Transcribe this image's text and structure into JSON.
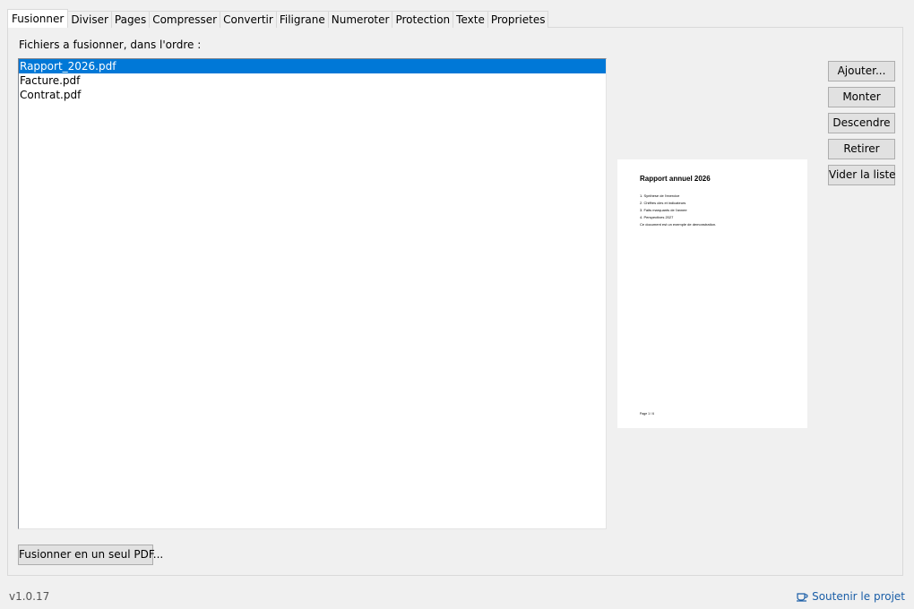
{
  "tabs": [
    "Fusionner",
    "Diviser",
    "Pages",
    "Compresser",
    "Convertir",
    "Filigrane",
    "Numeroter",
    "Protection",
    "Texte",
    "Proprietes"
  ],
  "merge": {
    "list_label": "Fichiers a fusionner, dans l'ordre :",
    "files": [
      "Rapport_2026.pdf",
      "Facture.pdf",
      "Contrat.pdf"
    ],
    "selected_file": "Rapport_2026.pdf",
    "buttons": {
      "add": "Ajouter...",
      "up": "Monter",
      "down": "Descendre",
      "remove": "Retirer",
      "clear": "Vider la liste"
    },
    "merge_button": "Fusionner en un seul PDF..."
  },
  "preview": {
    "title": "Rapport annuel 2026",
    "lines": [
      "1. Synthese de l'exercice",
      "2. Chiffres cles et indicateurs",
      "3. Faits marquants de l'annee",
      "4. Perspectives 2027",
      "Ce document est un exemple de demonstration."
    ],
    "footer": "Page 1 / 6"
  },
  "footer": {
    "version": "v1.0.17",
    "support_label": "Soutenir le projet",
    "support_icon": "coffee-cup-icon"
  },
  "colors": {
    "selection": "#0078d7",
    "link": "#1a5ea7"
  }
}
